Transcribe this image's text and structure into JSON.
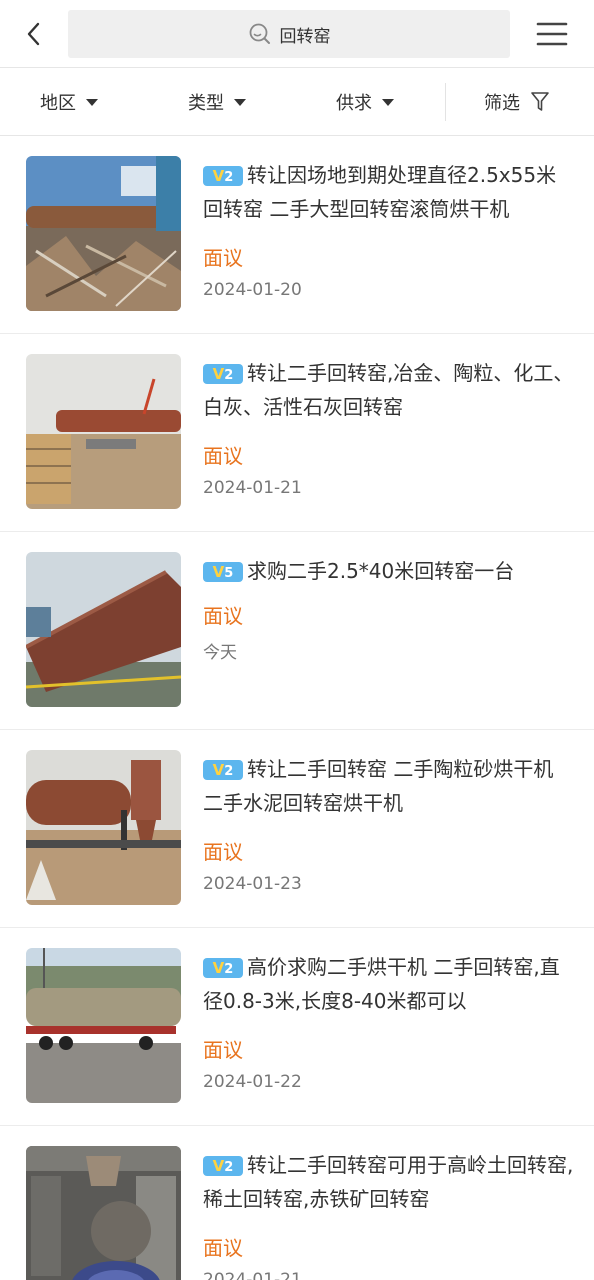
{
  "header": {
    "search_query": "回转窑"
  },
  "filters": [
    {
      "label": "地区"
    },
    {
      "label": "类型"
    },
    {
      "label": "供求"
    },
    {
      "label": "筛选"
    }
  ],
  "items": [
    {
      "badge": "2",
      "title": "转让因场地到期处理直径2.5x55米回转窑 二手大型回转窑滚筒烘干机",
      "price": "面议",
      "date": "2024-01-20"
    },
    {
      "badge": "2",
      "title": "转让二手回转窑,冶金、陶粒、化工、白灰、活性石灰回转窑",
      "price": "面议",
      "date": "2024-01-21"
    },
    {
      "badge": "5",
      "title": "求购二手2.5*40米回转窑一台",
      "price": "面议",
      "date": "今天"
    },
    {
      "badge": "2",
      "title": "转让二手回转窑 二手陶粒砂烘干机 二手水泥回转窑烘干机",
      "price": "面议",
      "date": "2024-01-23"
    },
    {
      "badge": "2",
      "title": "高价求购二手烘干机 二手回转窑,直径0.8-3米,长度8-40米都可以",
      "price": "面议",
      "date": "2024-01-22"
    },
    {
      "badge": "2",
      "title": "转让二手回转窑可用于高岭土回转窑,稀土回转窑,赤铁矿回转窑",
      "price": "面议",
      "date": "2024-01-21"
    }
  ]
}
